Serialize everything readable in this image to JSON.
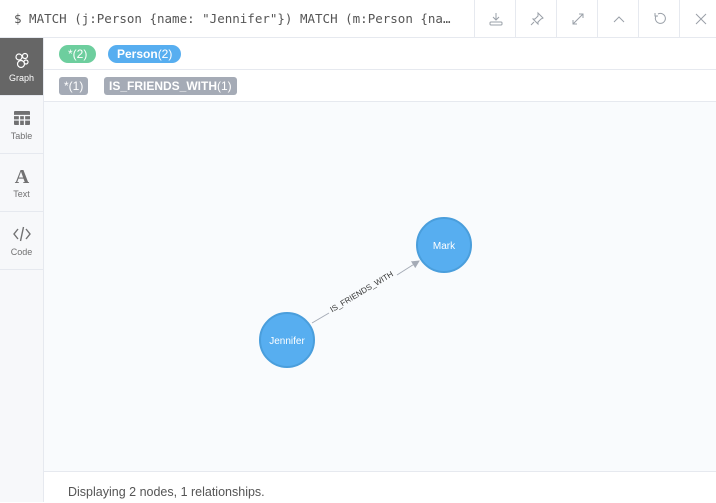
{
  "query": "$ MATCH (j:Person {name: \"Jennifer\"}) MATCH (m:Person {na…",
  "toolbar": [
    "download-icon",
    "pin-icon",
    "expand-icon",
    "collapse-icon",
    "rerun-icon",
    "close-icon"
  ],
  "sidebar": {
    "items": [
      {
        "label": "Graph",
        "active": true
      },
      {
        "label": "Table"
      },
      {
        "label": "Text"
      },
      {
        "label": "Code"
      }
    ]
  },
  "labels": {
    "all": {
      "name": "*",
      "count": "(2)",
      "color": "#6dce9e"
    },
    "person": {
      "name": "Person",
      "count": "(2)",
      "color": "#57aef0"
    }
  },
  "relationships": {
    "all": {
      "name": "*",
      "count": "(1)"
    },
    "friends": {
      "name": "IS_FRIENDS_WITH",
      "count": "(1)"
    }
  },
  "graph": {
    "nodes": [
      {
        "id": "jennifer",
        "label": "Jennifer",
        "color": "#57aef0"
      },
      {
        "id": "mark",
        "label": "Mark",
        "color": "#57aef0"
      }
    ],
    "edge": {
      "from": "jennifer",
      "to": "mark",
      "label": "IS_FRIENDS_WITH"
    }
  },
  "status": "Displaying 2 nodes, 1 relationships."
}
